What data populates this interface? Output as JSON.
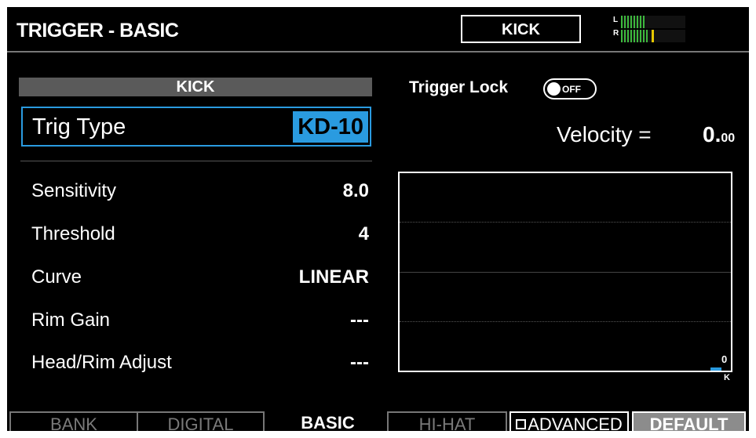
{
  "header": {
    "title": "TRIGGER - BASIC",
    "instrument": "KICK",
    "meter": {
      "left_label": "L",
      "right_label": "R",
      "left_level": 0.36,
      "right_level": 0.45
    }
  },
  "left_panel": {
    "section_label": "KICK",
    "trig_type": {
      "label": "Trig Type",
      "value": "KD-10"
    },
    "params": [
      {
        "name": "Sensitivity",
        "value": "8.0"
      },
      {
        "name": "Threshold",
        "value": "4"
      },
      {
        "name": "Curve",
        "value": "LINEAR"
      },
      {
        "name": "Rim Gain",
        "value": "---"
      },
      {
        "name": "Head/Rim Adjust",
        "value": "---"
      }
    ]
  },
  "right_panel": {
    "trigger_lock": {
      "label": "Trigger Lock",
      "state": "OFF"
    },
    "velocity": {
      "label": "Velocity =",
      "int": "0.",
      "dec": "00"
    },
    "graph": {
      "value_label": "0",
      "pad_label": "K"
    }
  },
  "tabs": {
    "bank": "BANK",
    "digital": "DIGITAL",
    "basic": "BASIC",
    "hihat": "HI-HAT",
    "advanced": "ADVANCED",
    "default": "DEFAULT"
  },
  "colors": {
    "accent": "#2a9be0",
    "meter_green": "#3db83d",
    "meter_yellow": "#e6c700"
  }
}
